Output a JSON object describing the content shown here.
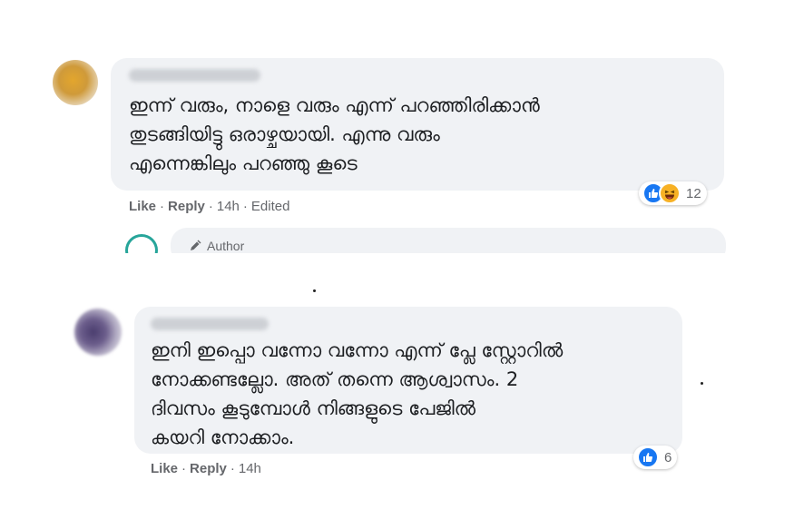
{
  "comments": [
    {
      "text_lines": [
        "ഇന്ന് വരും, നാളെ വരും എന്ന് പറഞ്ഞിരിക്കാൻ",
        "തുടങ്ങിയിട്ടു ഒരാഴ്ചയായി. എന്നു വരും",
        "എന്നെങ്കിലും പറഞ്ഞു കൂടെ"
      ],
      "actions": {
        "like": "Like",
        "reply": "Reply",
        "time": "14h",
        "edited": "Edited"
      },
      "reaction_count": "12",
      "reactions": [
        "like-icon",
        "haha-icon"
      ]
    },
    {
      "text_lines": [
        "ഇനി ഇപ്പൊ വന്നോ വന്നോ എന്ന് പ്ലേ സ്റ്റോറിൽ",
        "നോക്കണ്ടല്ലോ. അത് തന്നെ ആശ്വാസം. 2",
        "ദിവസം കൂടുമ്പോൾ നിങ്ങളുടെ പേജിൽ",
        "കയറി നോക്കാം."
      ],
      "actions": {
        "like": "Like",
        "reply": "Reply",
        "time": "14h"
      },
      "reaction_count": "6",
      "reactions": [
        "like-icon"
      ]
    }
  ],
  "reply_preview": {
    "author_label": "Author",
    "icon": "pencil-icon"
  },
  "separators": {
    "dot": "·"
  },
  "colors": {
    "bubble": "#f0f2f5",
    "like_blue": "#1877f2",
    "haha_yellow": "#f7b125",
    "meta_gray": "#65676b"
  }
}
